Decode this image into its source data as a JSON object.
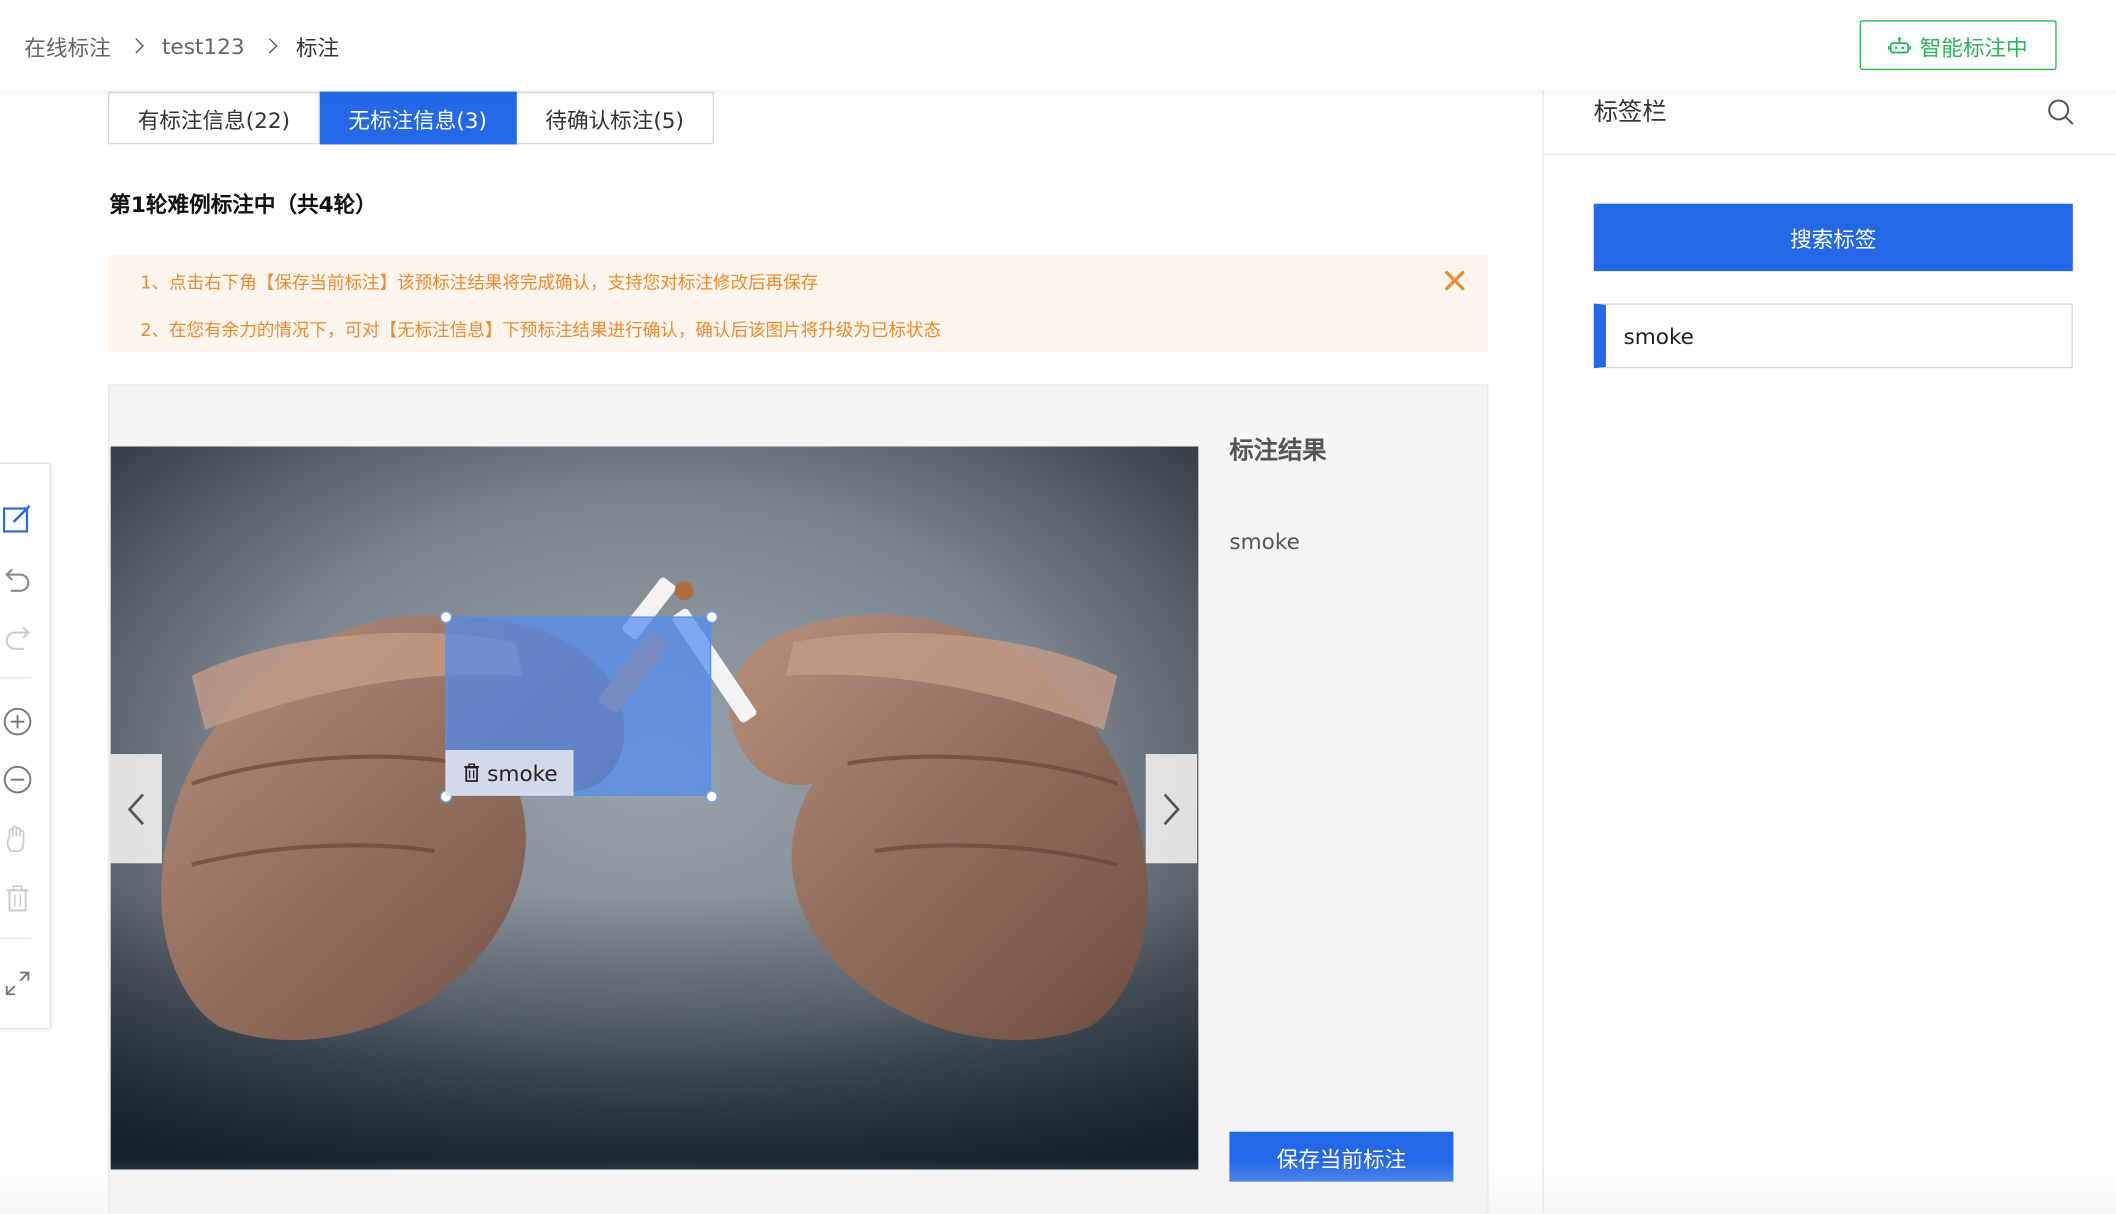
{
  "breadcrumb": {
    "items": [
      "在线标注",
      "test123",
      "标注"
    ]
  },
  "header": {
    "ai_button_label": "智能标注中",
    "ai_icon": "robot-icon"
  },
  "tabs": [
    {
      "label": "有标注信息(22)",
      "active": false
    },
    {
      "label": "无标注信息(3)",
      "active": true
    },
    {
      "label": "待确认标注(5)",
      "active": false
    }
  ],
  "round_title": "第1轮难例标注中（共4轮）",
  "notice": {
    "lines": [
      "1、点击右下角【保存当前标注】该预标注结果将完成确认，支持您对标注修改后再保存",
      "2、在您有余力的情况下，可对【无标注信息】下预标注结果进行确认，确认后该图片将升级为已标状态"
    ],
    "close_icon": "close-icon"
  },
  "canvas": {
    "image_description_icon": "photo",
    "bbox_label": "smoke",
    "bbox_icon": "trash-icon"
  },
  "result": {
    "title": "标注结果",
    "items": [
      "smoke"
    ],
    "save_label": "保存当前标注"
  },
  "toolbar": {
    "tools": [
      "edit-icon",
      "undo-icon",
      "redo-icon",
      "zoom-in-icon",
      "zoom-out-icon",
      "hand-icon",
      "trash-icon",
      "fullscreen-icon"
    ]
  },
  "sidebar": {
    "title": "标签栏",
    "search_button_label": "搜索标签",
    "labels": [
      "smoke"
    ]
  },
  "colors": {
    "primary": "#2468e8",
    "ai_green": "#2db35c",
    "notice_text": "#ee8a2e",
    "notice_bg": "#fdf5ee"
  }
}
